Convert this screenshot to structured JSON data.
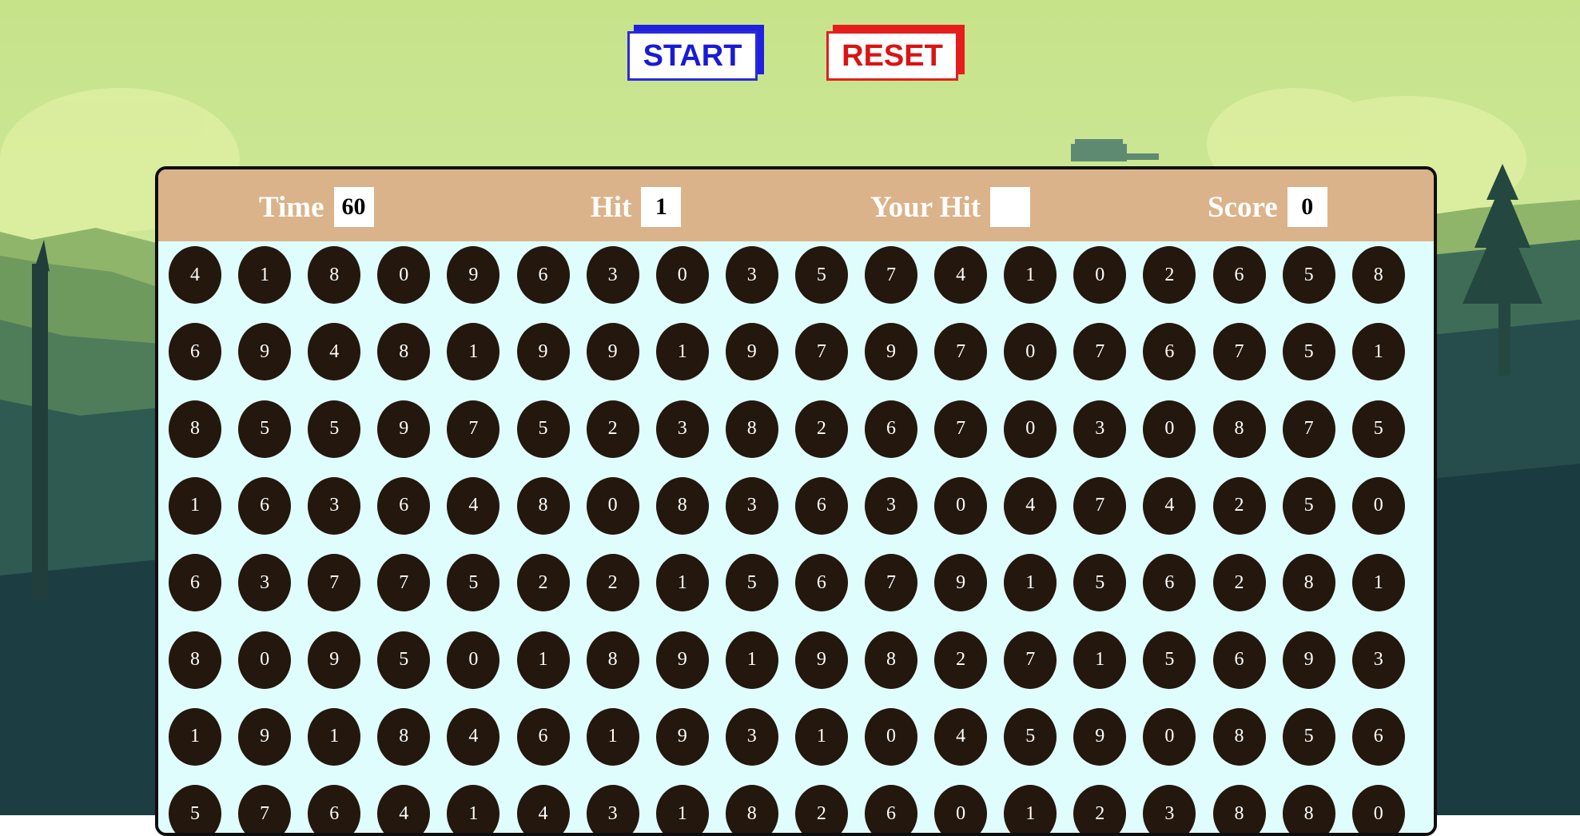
{
  "controls": {
    "start_label": "START",
    "reset_label": "RESET"
  },
  "stats": {
    "time_label": "Time",
    "time_value": "60",
    "hit_label": "Hit",
    "hit_value": "1",
    "your_hit_label": "Your Hit",
    "your_hit_value": "",
    "score_label": "Score",
    "score_value": "0"
  },
  "colors": {
    "sky": "#cce690",
    "panel_header": "#dbb38a",
    "panel_body": "#e0fdfe",
    "bubble": "#24170d",
    "start": "#2020e0",
    "reset": "#e81c1c"
  },
  "bubbles": [
    [
      "4",
      "1",
      "8",
      "0",
      "9",
      "6",
      "3",
      "0",
      "3",
      "5",
      "7",
      "4",
      "1",
      "0",
      "2",
      "6",
      "5",
      "8"
    ],
    [
      "6",
      "9",
      "4",
      "8",
      "1",
      "9",
      "9",
      "1",
      "9",
      "7",
      "9",
      "7",
      "0",
      "7",
      "6",
      "7",
      "5",
      "1"
    ],
    [
      "8",
      "5",
      "5",
      "9",
      "7",
      "5",
      "2",
      "3",
      "8",
      "2",
      "6",
      "7",
      "0",
      "3",
      "0",
      "8",
      "7",
      "5"
    ],
    [
      "1",
      "6",
      "3",
      "6",
      "4",
      "8",
      "0",
      "8",
      "3",
      "6",
      "3",
      "0",
      "4",
      "7",
      "4",
      "2",
      "5",
      "0"
    ],
    [
      "6",
      "3",
      "7",
      "7",
      "5",
      "2",
      "2",
      "1",
      "5",
      "6",
      "7",
      "9",
      "1",
      "5",
      "6",
      "2",
      "8",
      "1"
    ],
    [
      "8",
      "0",
      "9",
      "5",
      "0",
      "1",
      "8",
      "9",
      "1",
      "9",
      "8",
      "2",
      "7",
      "1",
      "5",
      "6",
      "9",
      "3"
    ],
    [
      "1",
      "9",
      "1",
      "8",
      "4",
      "6",
      "1",
      "9",
      "3",
      "1",
      "0",
      "4",
      "5",
      "9",
      "0",
      "8",
      "5",
      "6"
    ],
    [
      "5",
      "7",
      "6",
      "4",
      "1",
      "4",
      "3",
      "1",
      "8",
      "2",
      "6",
      "0",
      "1",
      "2",
      "3",
      "8",
      "8",
      "0"
    ]
  ]
}
